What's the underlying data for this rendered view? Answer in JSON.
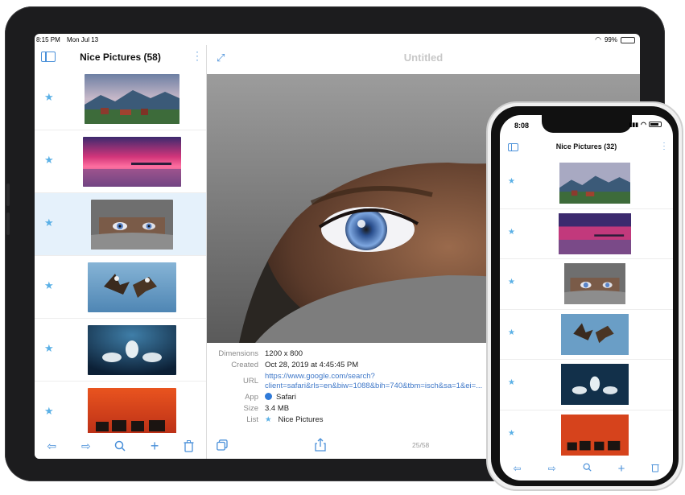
{
  "ipad": {
    "status": {
      "time": "8:15 PM",
      "date": "Mon Jul 13",
      "battery": "99%",
      "battery_level": 0.99
    },
    "sidebar": {
      "title": "Nice Pictures (58)",
      "items": [
        {
          "image": "mountain-village-thumbnail",
          "selected": false
        },
        {
          "image": "pink-sunset-pier-thumbnail",
          "selected": false
        },
        {
          "image": "hooded-eyes-thumbnail",
          "selected": true
        },
        {
          "image": "eagles-fighting-thumbnail",
          "selected": false
        },
        {
          "image": "beluga-whales-thumbnail",
          "selected": false
        },
        {
          "image": "elephants-sunset-thumbnail",
          "selected": false
        }
      ]
    },
    "detail": {
      "title": "Untitled",
      "info": {
        "dimensions_label": "Dimensions",
        "dimensions": "1200 x 800",
        "created_label": "Created",
        "created": "Oct 28, 2019 at 4:45:45 PM",
        "url_label": "URL",
        "url_line1": "https://www.google.com/search?",
        "url_line2": "client=safari&rls=en&biw=1088&bih=740&tbm=isch&sa=1&ei=...",
        "app_label": "App",
        "app": "Safari",
        "size_label": "Size",
        "size": "3.4 MB",
        "list_label": "List",
        "list": "Nice Pictures"
      },
      "page_indicator": "25/58"
    }
  },
  "iphone": {
    "status": {
      "time": "8:08"
    },
    "title": "Nice Pictures (32)",
    "items": [
      {
        "image": "mountain-village-thumbnail"
      },
      {
        "image": "pink-sunset-pier-thumbnail"
      },
      {
        "image": "hooded-eyes-thumbnail"
      },
      {
        "image": "eagles-fighting-thumbnail"
      },
      {
        "image": "beluga-whales-thumbnail"
      },
      {
        "image": "elephants-sunset-thumbnail"
      }
    ]
  },
  "colors": {
    "accent": "#4a90d9",
    "star": "#5ab0e6",
    "selected_row": "#e5f1fb",
    "link": "#3f78c8"
  }
}
